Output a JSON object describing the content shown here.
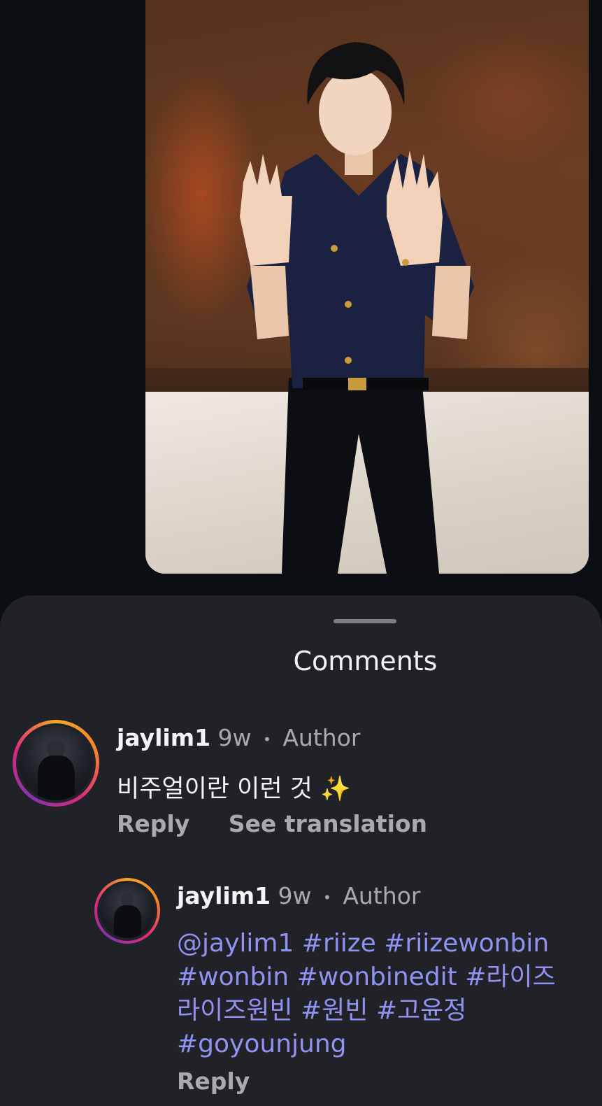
{
  "sheet": {
    "title": "Comments"
  },
  "comments": [
    {
      "username": "jaylim1",
      "time": "9w",
      "separator": "•",
      "badge": "Author",
      "text": "비주얼이란 이런 것 ✨",
      "actions": {
        "reply": "Reply",
        "translate": "See translation"
      }
    },
    {
      "username": "jaylim1",
      "time": "9w",
      "separator": "•",
      "badge": "Author",
      "tag_lines": [
        "@jaylim1 #riize #riizewonbin",
        "#wonbin #wonbinedit #라이즈",
        "라이즈원빈 #원빈 #고윤정",
        "#goyounjung"
      ],
      "actions": {
        "reply": "Reply"
      }
    }
  ],
  "colors": {
    "background": "#0b0e13",
    "sheet": "#202227",
    "hashtag": "#8f93f2",
    "secondary_text": "#a8aab0"
  }
}
